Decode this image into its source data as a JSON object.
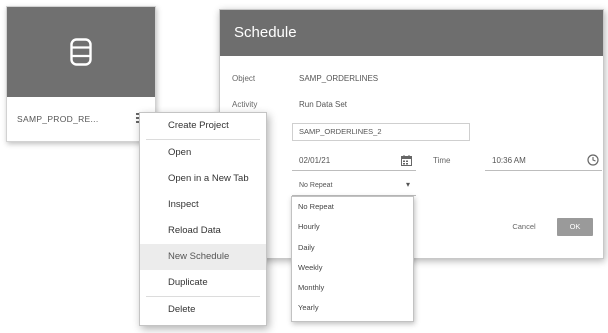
{
  "card": {
    "name": "SAMP_PROD_RE...",
    "icon": "database-icon"
  },
  "context_menu": {
    "items": [
      {
        "label": "Create Project",
        "icon": ""
      },
      {
        "label": "Open"
      },
      {
        "label": "Open in a New Tab"
      },
      {
        "label": "Inspect"
      },
      {
        "label": "Reload Data"
      },
      {
        "label": "New Schedule"
      },
      {
        "label": "Duplicate"
      },
      {
        "label": "Delete"
      }
    ],
    "highlighted": "New Schedule"
  },
  "dialog": {
    "title": "Schedule",
    "object_label": "Object",
    "object_value": "SAMP_ORDERLINES",
    "activity_label": "Activity",
    "activity_value": "Run Data Set",
    "name_value": "SAMP_ORDERLINES_2",
    "date_value": "02/01/21",
    "time_label": "Time",
    "time_value": "10:36 AM",
    "repeat_value": "No Repeat",
    "cancel_label": "Cancel",
    "ok_label": "OK"
  },
  "repeat_options": [
    "No Repeat",
    "Hourly",
    "Daily",
    "Weekly",
    "Monthly",
    "Yearly"
  ],
  "colors": {
    "header": "#6e6e6e",
    "thumb": "#707070",
    "ok_button": "#9a9a9a",
    "highlight": "#ececec"
  }
}
